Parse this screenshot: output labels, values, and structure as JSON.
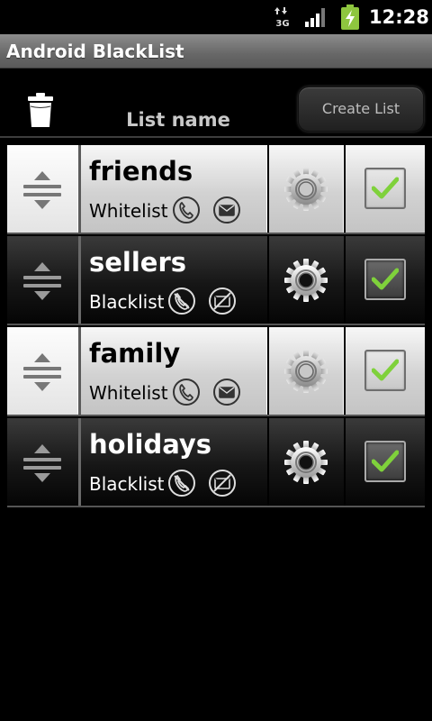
{
  "status_bar": {
    "network": "3G",
    "time": "12:28"
  },
  "app": {
    "title": "Android BlackList"
  },
  "header": {
    "column_label": "List name",
    "create_button_label": "Create List"
  },
  "lists": [
    {
      "name": "friends",
      "type": "Whitelist",
      "calls_blocked": false,
      "sms_blocked": false,
      "enabled": true,
      "theme": "light"
    },
    {
      "name": "sellers",
      "type": "Blacklist",
      "calls_blocked": true,
      "sms_blocked": true,
      "enabled": true,
      "theme": "dark"
    },
    {
      "name": "family",
      "type": "Whitelist",
      "calls_blocked": false,
      "sms_blocked": false,
      "enabled": true,
      "theme": "light"
    },
    {
      "name": "holidays",
      "type": "Blacklist",
      "calls_blocked": true,
      "sms_blocked": true,
      "enabled": true,
      "theme": "dark"
    }
  ],
  "colors": {
    "check_green": "#7fd13b",
    "title_bar": "#6e6e6e"
  }
}
